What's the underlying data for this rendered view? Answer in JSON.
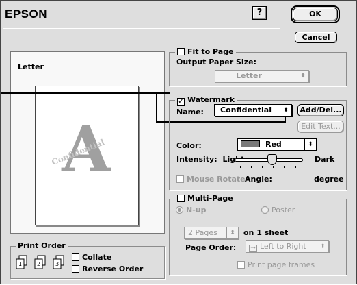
{
  "header": {
    "title": "EPSON",
    "help_label": "?",
    "ok_label": "OK",
    "cancel_label": "Cancel"
  },
  "preview": {
    "paper_label": "Letter",
    "watermark_letter": "A",
    "watermark_text": "Confidential"
  },
  "fit_to_page": {
    "label": "Fit to Page",
    "checked": false,
    "output_size_label": "Output Paper Size:",
    "output_size_value": "Letter"
  },
  "watermark": {
    "label": "Watermark",
    "checked": true,
    "checked_glyph": "✓",
    "name_label": "Name:",
    "name_value": "Confidential",
    "add_del_label": "Add/Del...",
    "edit_text_label": "Edit Text...",
    "color_label": "Color:",
    "color_value": "Red",
    "color_swatch": "#7a7a7a",
    "intensity_label": "Intensity:",
    "intensity_light": "Light",
    "intensity_dark": "Dark",
    "mouse_rotate_label": "Mouse Rotate",
    "angle_label": "Angle:",
    "angle_unit": "degree"
  },
  "multi_page": {
    "label": "Multi-Page",
    "checked": false,
    "nup_label": "N-up",
    "poster_label": "Poster",
    "pages_value": "2 Pages",
    "pages_suffix": "on 1 sheet",
    "page_order_label": "Page Order:",
    "page_order_value": "Left to Right",
    "page_order_icon": "→",
    "print_frames_label": "Print page frames"
  },
  "print_order": {
    "label": "Print Order",
    "collate_label": "Collate",
    "reverse_label": "Reverse Order",
    "page_icon_numbers": [
      "1",
      "2",
      "3"
    ]
  },
  "icons": {
    "popup_arrows": "⬍"
  },
  "colors": {
    "dialog_bg": "#dedede",
    "disabled_text": "#999999"
  }
}
